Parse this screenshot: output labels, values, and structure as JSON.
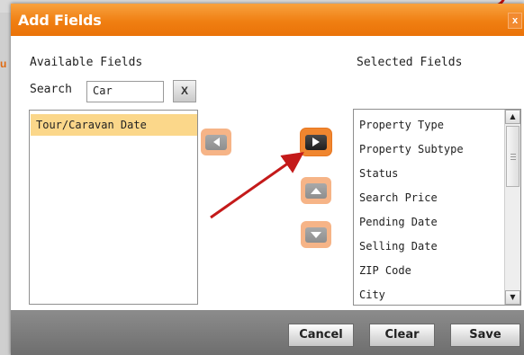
{
  "background": {
    "left_fragment": "u"
  },
  "dialog": {
    "title": "Add Fields",
    "close_label": "x"
  },
  "available": {
    "label": "Available Fields",
    "search_label": "Search",
    "search_value": "Car",
    "clear_search_label": "X",
    "items": [
      "Tour/Caravan Date"
    ]
  },
  "selected": {
    "label": "Selected Fields",
    "items": [
      "Property Type",
      "Property Subtype",
      "Status",
      "Search Price",
      "Pending Date",
      "Selling Date",
      "ZIP Code",
      "City"
    ]
  },
  "footer": {
    "cancel": "Cancel",
    "clear": "Clear",
    "save": "Save"
  },
  "colors": {
    "title_bar": "#f07f12",
    "highlight_row": "#fbd78a",
    "annotation_arrow": "#c41a1a"
  }
}
